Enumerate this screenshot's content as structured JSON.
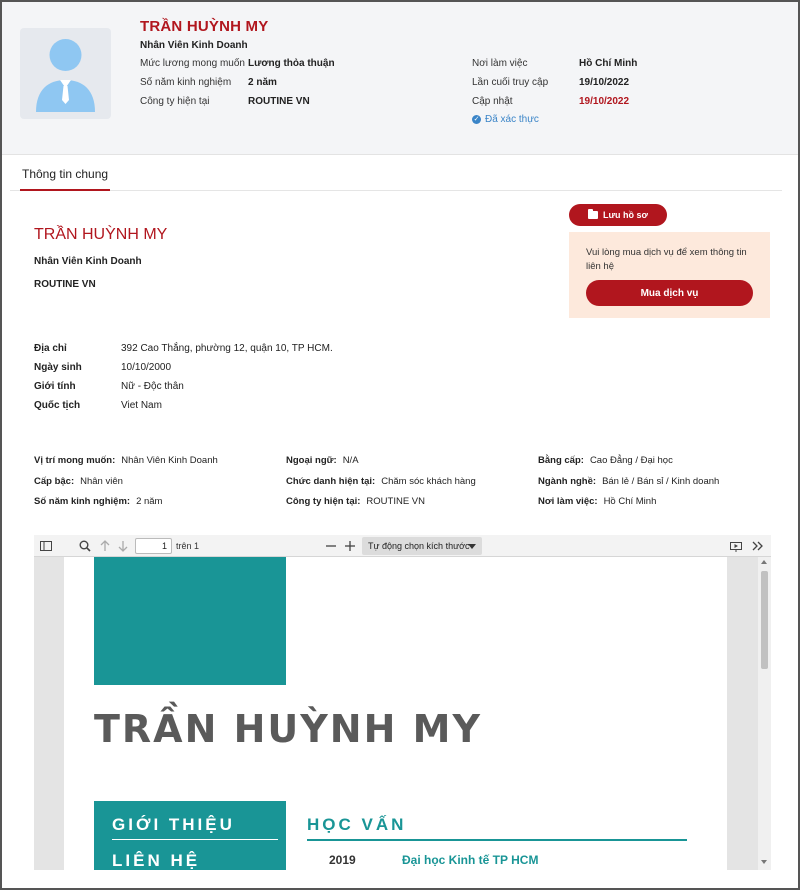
{
  "header": {
    "name": "TRẦN HUỲNH MY",
    "job_title": "Nhân Viên Kinh Doanh",
    "left_fields": [
      {
        "label": "Mức lương mong muốn",
        "value": "Lương thỏa thuận"
      },
      {
        "label": "Số năm kinh nghiệm",
        "value": "2 năm"
      },
      {
        "label": "Công ty hiện tại",
        "value": "ROUTINE VN"
      }
    ],
    "right_fields": [
      {
        "label": "Nơi làm việc",
        "value": "Hồ Chí Minh"
      },
      {
        "label": "Lần cuối truy cập",
        "value": "19/10/2022"
      },
      {
        "label": "Cập nhật",
        "value": "19/10/2022"
      }
    ],
    "verified_label": "Đã xác thực",
    "colors": {
      "accent": "#b1161e",
      "verified": "#3b85c8"
    }
  },
  "tabs": [
    {
      "label": "Thông tin chung",
      "active": true
    }
  ],
  "profile": {
    "name": "TRẦN HUỲNH MY",
    "job_title": "Nhân Viên Kinh Doanh",
    "company": "ROUTINE VN",
    "personal": [
      {
        "label": "Địa chỉ",
        "value": "392 Cao Thắng, phường 12, quận 10, TP HCM."
      },
      {
        "label": "Ngày sinh",
        "value": "10/10/2000"
      },
      {
        "label": "Giới tính",
        "value": "Nữ - Độc thân"
      },
      {
        "label": "Quốc tịch",
        "value": "Viet Nam"
      }
    ],
    "details": [
      {
        "label": "Vị trí mong muốn:",
        "value": "Nhân Viên Kinh Doanh"
      },
      {
        "label": "Ngoại ngữ:",
        "value": "N/A"
      },
      {
        "label": "Bằng cấp:",
        "value": "Cao Đẳng / Đại học"
      },
      {
        "label": "Cấp bậc:",
        "value": "Nhân viên"
      },
      {
        "label": "Chức danh hiện tại:",
        "value": "Chăm sóc khách hàng"
      },
      {
        "label": "Ngành nghề:",
        "value": "Bán lẻ / Bán sỉ / Kinh doanh"
      },
      {
        "label": "Số năm kinh nghiệm:",
        "value": "2 năm"
      },
      {
        "label": "Công ty hiện tại:",
        "value": "ROUTINE VN"
      },
      {
        "label": "Nơi làm việc:",
        "value": "Hồ Chí Minh"
      }
    ]
  },
  "actions": {
    "save_label": "Lưu hồ sơ",
    "notice_text": "Vui lòng mua dịch vụ để xem thông tin liên hệ",
    "buy_label": "Mua dịch vụ"
  },
  "pdf_viewer": {
    "page_value": "1",
    "page_of": "trên 1",
    "zoom_label": "Tự động chọn kích thước",
    "icons": [
      "sidebar-toggle-icon",
      "search-icon",
      "arrow-up-icon",
      "arrow-down-icon",
      "minus-icon",
      "plus-icon",
      "presentation-icon",
      "double-chevron-right-icon"
    ]
  },
  "cv": {
    "name": "TRẦN HUỲNH MY",
    "side_heading_1": "GIỚI THIỆU",
    "side_heading_2": "LIÊN HỆ",
    "education_heading": "HỌC VẤN",
    "education": [
      {
        "year": "2019",
        "school": "Đại học Kinh tế TP HCM"
      }
    ],
    "colors": {
      "teal": "#199596",
      "name_gray": "#5a5a5a"
    }
  }
}
